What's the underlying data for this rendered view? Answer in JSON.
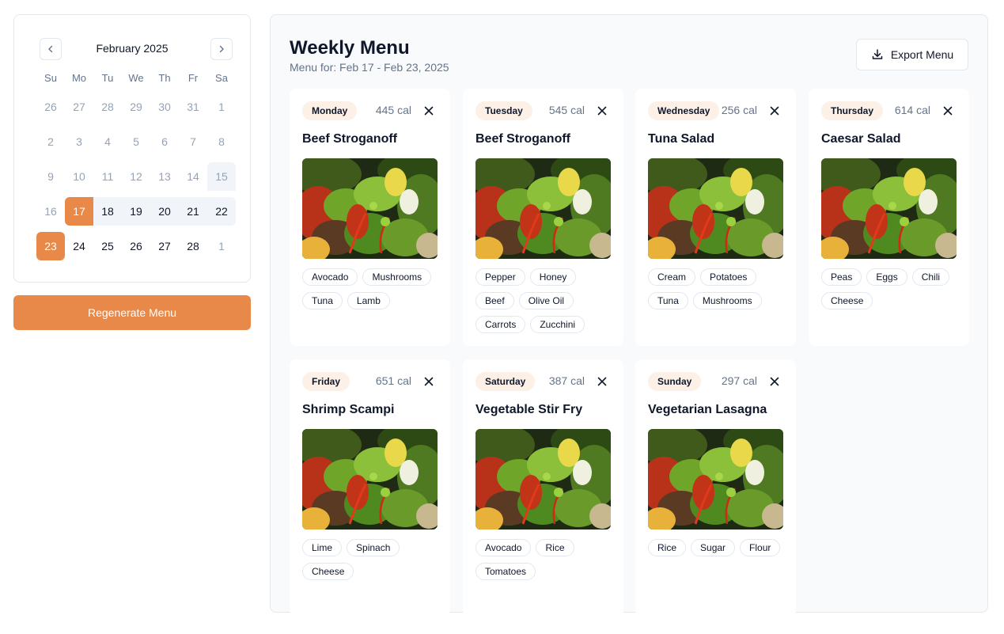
{
  "calendar": {
    "month_label": "February 2025",
    "weekdays": [
      "Su",
      "Mo",
      "Tu",
      "We",
      "Th",
      "Fr",
      "Sa"
    ],
    "days": [
      {
        "label": "26",
        "state": "out"
      },
      {
        "label": "27",
        "state": "out"
      },
      {
        "label": "28",
        "state": "out"
      },
      {
        "label": "29",
        "state": "out"
      },
      {
        "label": "30",
        "state": "out"
      },
      {
        "label": "31",
        "state": "out"
      },
      {
        "label": "1",
        "state": "out"
      },
      {
        "label": "2",
        "state": "out"
      },
      {
        "label": "3",
        "state": "out"
      },
      {
        "label": "4",
        "state": "out"
      },
      {
        "label": "5",
        "state": "out"
      },
      {
        "label": "6",
        "state": "out"
      },
      {
        "label": "7",
        "state": "out"
      },
      {
        "label": "8",
        "state": "out"
      },
      {
        "label": "9",
        "state": "out"
      },
      {
        "label": "10",
        "state": "out"
      },
      {
        "label": "11",
        "state": "out"
      },
      {
        "label": "12",
        "state": "out"
      },
      {
        "label": "13",
        "state": "out"
      },
      {
        "label": "14",
        "state": "out"
      },
      {
        "label": "15",
        "state": "out-range"
      },
      {
        "label": "16",
        "state": "out"
      },
      {
        "label": "17",
        "state": "selected-start"
      },
      {
        "label": "18",
        "state": "range"
      },
      {
        "label": "19",
        "state": "range"
      },
      {
        "label": "20",
        "state": "range"
      },
      {
        "label": "21",
        "state": "range"
      },
      {
        "label": "22",
        "state": "range-end"
      },
      {
        "label": "23",
        "state": "selected"
      },
      {
        "label": "24",
        "state": "normal"
      },
      {
        "label": "25",
        "state": "normal"
      },
      {
        "label": "26",
        "state": "normal"
      },
      {
        "label": "27",
        "state": "normal"
      },
      {
        "label": "28",
        "state": "normal"
      },
      {
        "label": "1",
        "state": "out"
      }
    ]
  },
  "regenerate_label": "Regenerate Menu",
  "panel": {
    "title": "Weekly Menu",
    "subtitle": "Menu for: Feb 17 - Feb 23, 2025",
    "export_label": "Export Menu"
  },
  "colors": {
    "accent": "#e8894a",
    "day_pill": "#fdf0e7"
  },
  "meals": [
    {
      "day": "Monday",
      "calories": "445 cal",
      "name": "Beef Stroganoff",
      "ingredients": [
        "Avocado",
        "Mushrooms",
        "Tuna",
        "Lamb"
      ]
    },
    {
      "day": "Tuesday",
      "calories": "545 cal",
      "name": "Beef Stroganoff",
      "ingredients": [
        "Pepper",
        "Honey",
        "Beef",
        "Olive Oil",
        "Carrots",
        "Zucchini"
      ]
    },
    {
      "day": "Wednesday",
      "calories": "256 cal",
      "name": "Tuna Salad",
      "ingredients": [
        "Cream",
        "Potatoes",
        "Tuna",
        "Mushrooms"
      ]
    },
    {
      "day": "Thursday",
      "calories": "614 cal",
      "name": "Caesar Salad",
      "ingredients": [
        "Peas",
        "Eggs",
        "Chili",
        "Cheese"
      ]
    },
    {
      "day": "Friday",
      "calories": "651 cal",
      "name": "Shrimp Scampi",
      "ingredients": [
        "Lime",
        "Spinach",
        "Cheese"
      ]
    },
    {
      "day": "Saturday",
      "calories": "387 cal",
      "name": "Vegetable Stir Fry",
      "ingredients": [
        "Avocado",
        "Rice",
        "Tomatoes"
      ]
    },
    {
      "day": "Sunday",
      "calories": "297 cal",
      "name": "Vegetarian Lasagna",
      "ingredients": [
        "Rice",
        "Sugar",
        "Flour"
      ]
    }
  ]
}
